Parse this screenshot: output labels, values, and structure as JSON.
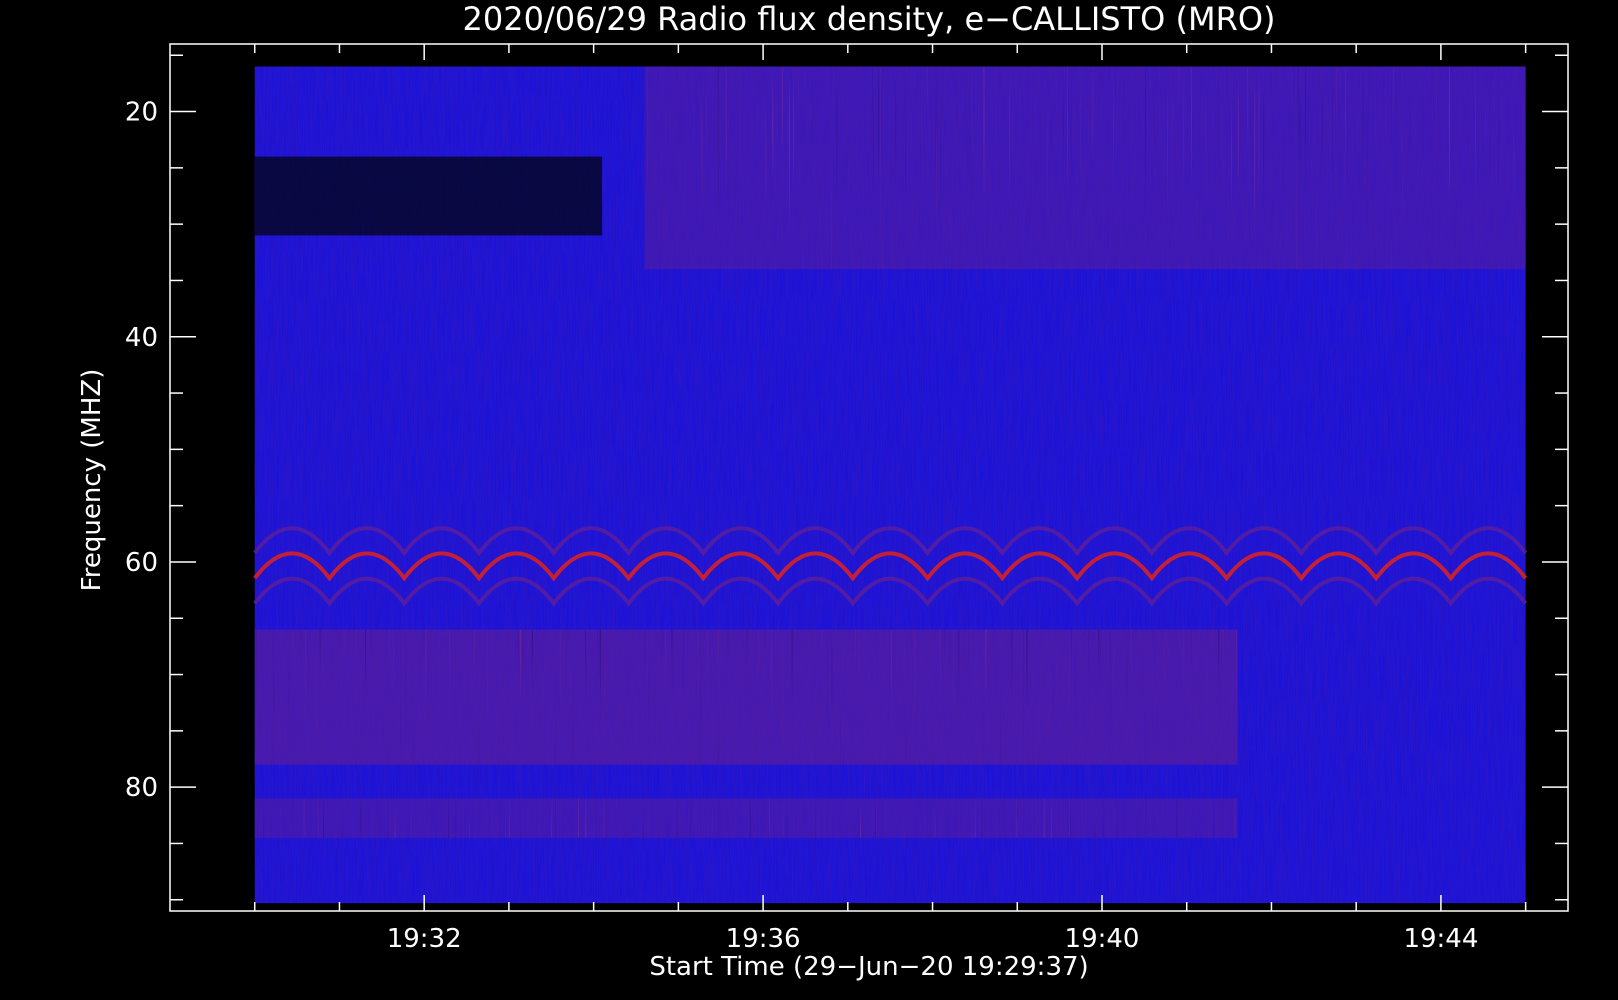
{
  "chart_data": {
    "type": "heatmap",
    "title": "2020/06/29  Radio flux density, e−CALLISTO (MRO)",
    "xlabel": "Start Time (29−Jun−20 19:29:37)",
    "ylabel": "Frequency (MHZ)",
    "x_ticks": [
      {
        "label": "19:32",
        "minutes": 2.4
      },
      {
        "label": "19:36",
        "minutes": 6.4
      },
      {
        "label": "19:40",
        "minutes": 10.4
      },
      {
        "label": "19:44",
        "minutes": 14.4
      }
    ],
    "xlim_minutes": [
      -0.6,
      15.9
    ],
    "y_ticks": [
      20,
      40,
      60,
      80
    ],
    "ylim": [
      91,
      14
    ],
    "data_extent": {
      "time_minutes": [
        0.4,
        15.4
      ],
      "frequency_mhz": [
        16.0,
        90.3
      ]
    },
    "colors": {
      "background": "#000000",
      "low": "#1b14d8",
      "mid": "#5a1d9c",
      "high": "#e0221a",
      "peak": "#ff9a20",
      "axis": "#ffffff"
    },
    "features": [
      {
        "description_id": "band-red",
        "frequency_mhz": [
          16,
          34
        ],
        "time_minutes": [
          5.0,
          15.4
        ],
        "intensity": "high"
      },
      {
        "description_id": "band-dark-left",
        "frequency_mhz": [
          24,
          31
        ],
        "time_minutes": [
          0.4,
          4.5
        ],
        "intensity": "low"
      },
      {
        "description_id": "arc-band",
        "frequency_mhz": [
          58,
          66
        ],
        "time_minutes": [
          0.4,
          15.4
        ],
        "intensity": "mid-high"
      },
      {
        "description_id": "band-red-low",
        "frequency_mhz": [
          66,
          78
        ],
        "time_minutes": [
          0.4,
          12.0
        ],
        "intensity": "mid"
      },
      {
        "description_id": "striped-band",
        "frequency_mhz": [
          81,
          84.5
        ],
        "time_minutes": [
          0.4,
          12.0
        ],
        "intensity": "high"
      }
    ]
  }
}
